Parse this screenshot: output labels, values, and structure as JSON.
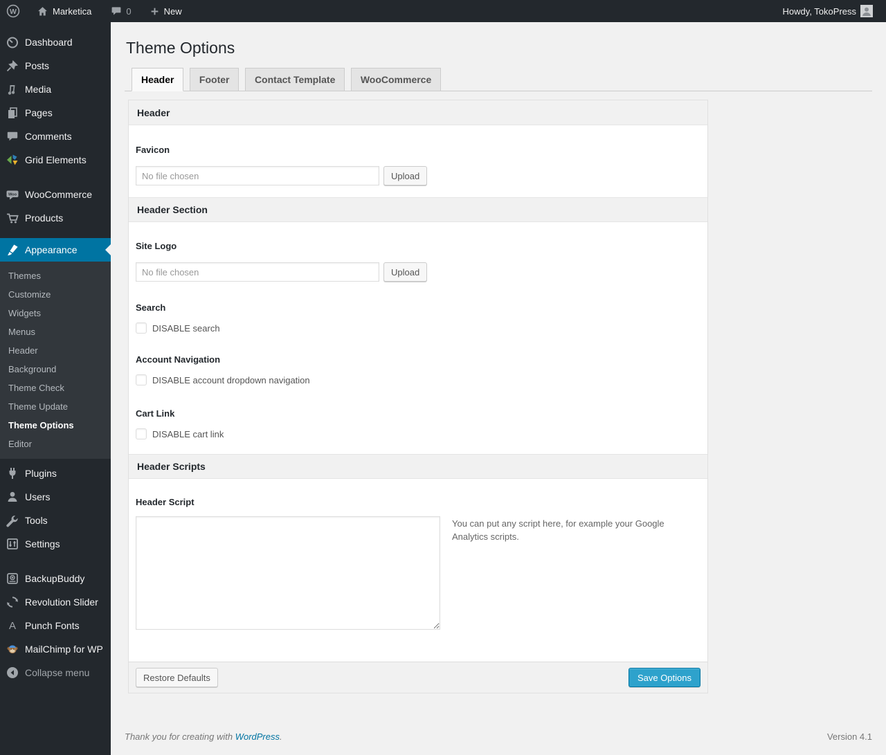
{
  "admin_bar": {
    "wp_logo_glyph": "W",
    "site_name": "Marketica",
    "comments_count": "0",
    "new_label": "New",
    "howdy": "Howdy, TokoPress"
  },
  "sidebar": {
    "group_main": [
      "Dashboard",
      "Posts",
      "Media",
      "Pages",
      "Comments",
      "Grid Elements"
    ],
    "group_shop": [
      "WooCommerce",
      "Products"
    ],
    "appearance_label": "Appearance",
    "appearance_submenu": [
      "Themes",
      "Customize",
      "Widgets",
      "Menus",
      "Header",
      "Background",
      "Theme Check",
      "Theme Update",
      "Theme Options",
      "Editor"
    ],
    "current_submenu_item": "Theme Options",
    "group_admin": [
      "Plugins",
      "Users",
      "Tools",
      "Settings"
    ],
    "group_plugins": [
      "BackupBuddy",
      "Revolution Slider",
      "Punch Fonts",
      "MailChimp for WP"
    ],
    "collapse_label": "Collapse menu"
  },
  "icons": {
    "woo_badge": "Woo",
    "punch_fonts_glyph": "A"
  },
  "page": {
    "title": "Theme Options"
  },
  "tabs": [
    "Header",
    "Footer",
    "Contact Template",
    "WooCommerce"
  ],
  "active_tab": "Header",
  "panel": {
    "section_header": {
      "title": "Header",
      "favicon_label": "Favicon",
      "favicon_placeholder": "No file chosen",
      "upload_label": "Upload"
    },
    "section_header_section": {
      "title": "Header Section",
      "site_logo_label": "Site Logo",
      "site_logo_placeholder": "No file chosen",
      "upload_label": "Upload",
      "search_label": "Search",
      "search_checkbox_label": "DISABLE search",
      "account_label": "Account Navigation",
      "account_checkbox_label": "DISABLE account dropdown navigation",
      "cart_label": "Cart Link",
      "cart_checkbox_label": "DISABLE cart link"
    },
    "section_header_scripts": {
      "title": "Header Scripts",
      "script_label": "Header Script",
      "script_value": "",
      "script_help": "You can put any script here, for example your Google Analytics scripts."
    },
    "footer": {
      "restore_label": "Restore Defaults",
      "save_label": "Save Options"
    }
  },
  "page_footer": {
    "thanks_text": "Thank you for creating with",
    "wordpress_link": "WordPress",
    "period": ".",
    "version": "Version 4.1"
  },
  "colors": {
    "accent_active_menu": "#0074a2",
    "primary_button": "#2ea2cc",
    "link": "#0074a2",
    "admin_dark": "#23282d"
  }
}
